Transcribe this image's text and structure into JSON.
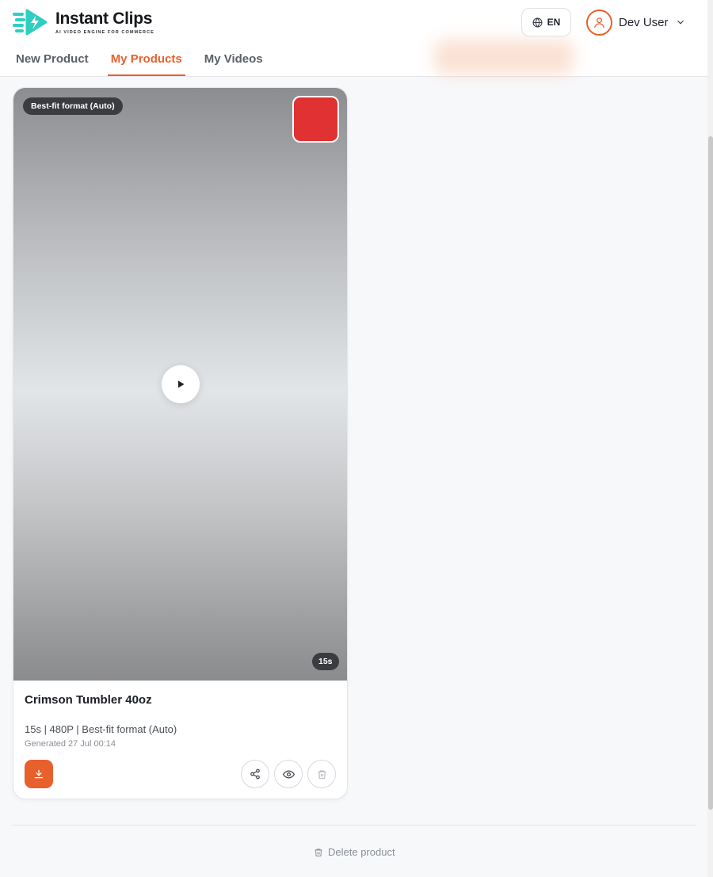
{
  "app": {
    "name": "Instant Clips",
    "tagline": "AI VIDEO ENGINE FOR COMMERCE",
    "accent_color": "#e8602c",
    "logo_color": "#2ecfc0"
  },
  "header": {
    "language": "EN",
    "user_name": "Dev User"
  },
  "tabs": [
    {
      "label": "New Product",
      "active": false
    },
    {
      "label": "My Products",
      "active": true
    },
    {
      "label": "My Videos",
      "active": false
    }
  ],
  "video_card": {
    "format_badge": "Best-fit format (Auto)",
    "thumbnail_color": "#e03232",
    "duration": "15s",
    "product_name": "Crimson Tumbler 40oz",
    "meta": "15s | 480P | Best-fit format (Auto)",
    "generated": "Generated 27 Jul 00:14",
    "actions": [
      "download-icon",
      "share-icon",
      "eye-icon",
      "trash-icon"
    ]
  },
  "footer": {
    "delete_product_label": "Delete product"
  }
}
